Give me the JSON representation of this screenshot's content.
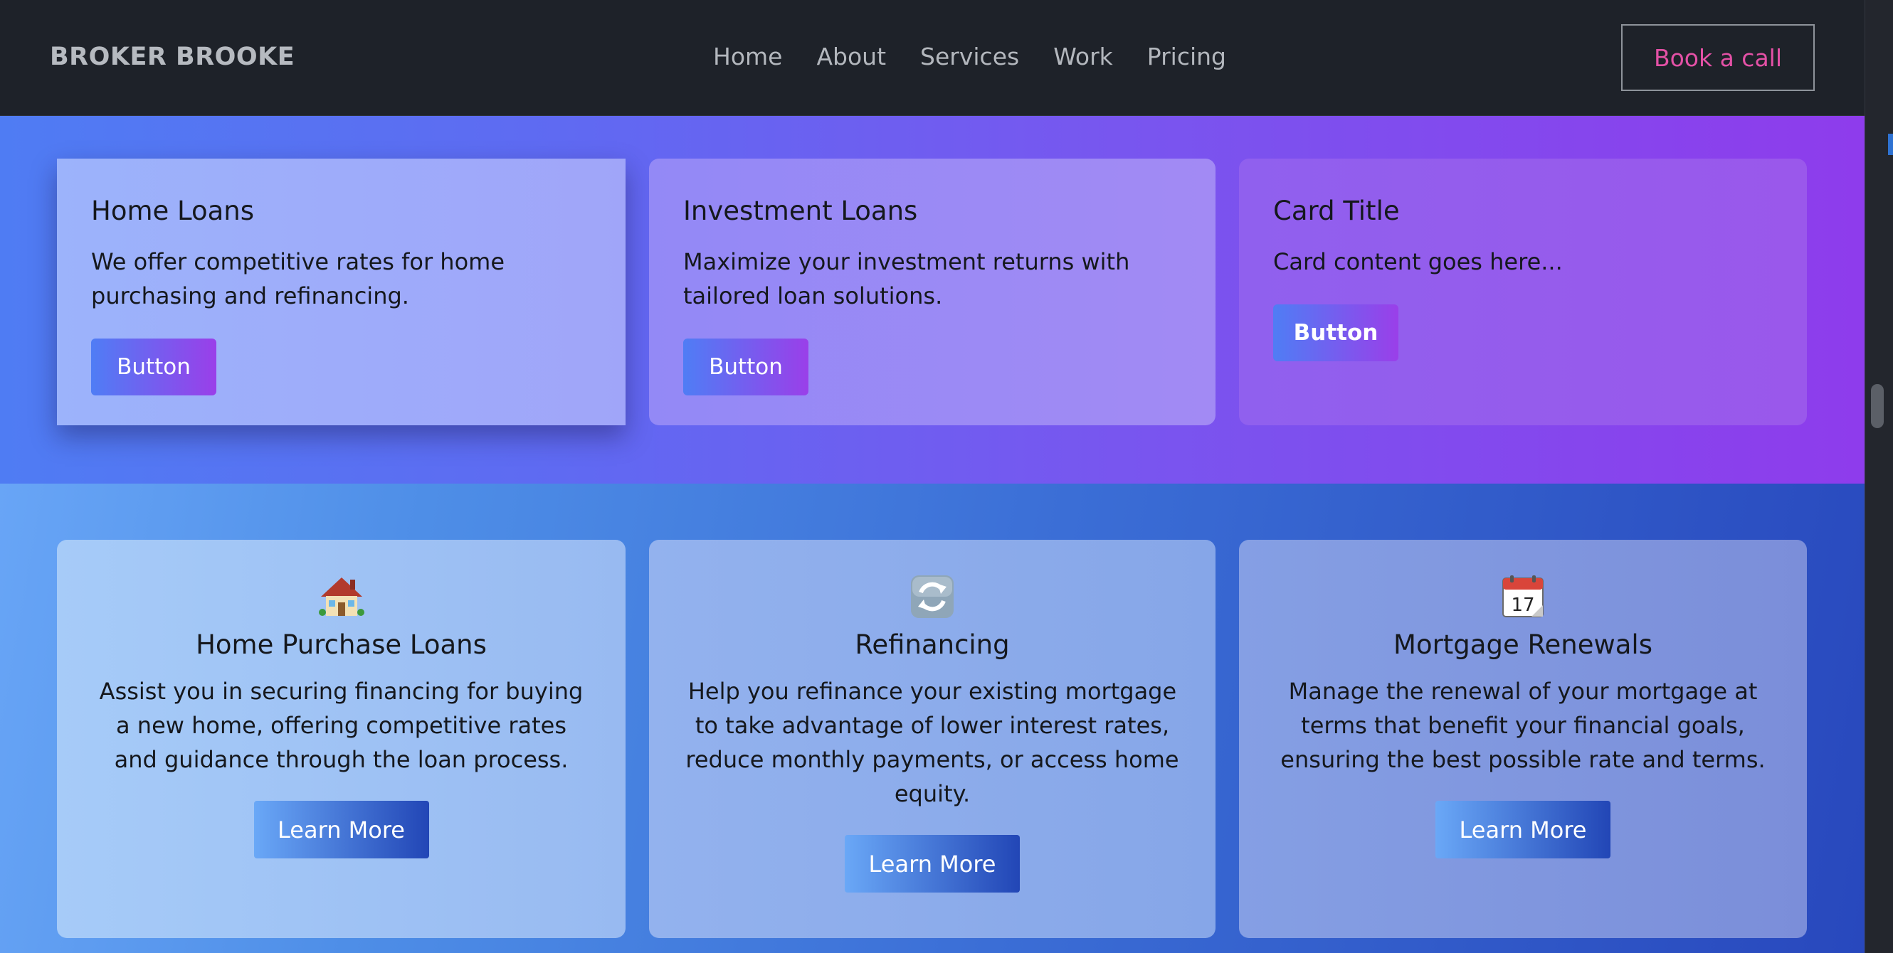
{
  "nav": {
    "brand": "BROKER BROOKE",
    "links": [
      "Home",
      "About",
      "Services",
      "Work",
      "Pricing"
    ],
    "cta": "Book a call"
  },
  "cards_top": [
    {
      "title": "Home Loans",
      "text": "We offer competitive rates for home purchasing and refinancing.",
      "button": "Button"
    },
    {
      "title": "Investment Loans",
      "text": "Maximize your investment returns with tailored loan solutions.",
      "button": "Button"
    },
    {
      "title": "Card Title",
      "text": "Card content goes here...",
      "button": "Button"
    }
  ],
  "services": [
    {
      "icon": "house-icon",
      "title": "Home Purchase Loans",
      "text": "Assist you in securing financing for buying a new home, offering competitive rates and guidance through the loan process.",
      "button": "Learn More"
    },
    {
      "icon": "refresh-icon",
      "title": "Refinancing",
      "text": "Help you refinance your existing mortgage to take advantage of lower interest rates, reduce monthly payments, or access home equity.",
      "button": "Learn More"
    },
    {
      "icon": "calendar-icon",
      "title": "Mortgage Renewals",
      "text": "Manage the renewal of your mortgage at terms that benefit your financial goals, ensuring the best possible rate and terms.",
      "button": "Learn More"
    }
  ],
  "calendar_icon_day": "17"
}
